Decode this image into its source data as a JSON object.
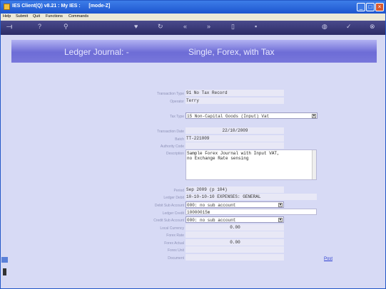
{
  "window": {
    "title": "IES Client(Q) v8.21 : My IES :      [mode-Z]"
  },
  "menu": [
    "Help",
    "Submit",
    "Quit",
    "Functions",
    "Commands"
  ],
  "header": {
    "left": "Ledger Journal: -",
    "right": "Single, Forex, with Tax"
  },
  "form": {
    "transaction_type": {
      "label": "Transaction Type",
      "value": "91 No Tax Record"
    },
    "operator": {
      "label": "Operator",
      "value": "Terry"
    },
    "tax_type": {
      "label": "Tax Type",
      "value": "15 Non-Capital Goods (Input) Vat"
    },
    "transaction_date": {
      "label": "Transaction Date",
      "value": "22/10/2009"
    },
    "batch": {
      "label": "Batch",
      "value": "TT-221009"
    },
    "authority_code": {
      "label": "Authority Code",
      "value": ""
    },
    "description": {
      "label": "Description",
      "line1": "Sample Forex Journal with Input VAT,",
      "line2": "no Exchange Rate sensing"
    },
    "period": {
      "label": "Period",
      "value": "Sep 2009 (p 104)"
    },
    "ledger_debit": {
      "label": "Ledger Debit",
      "value": "10-10-10-10 EXPENSES: GENERAL"
    },
    "debit_sub_account": {
      "label": "Debit Sub Account",
      "value": "000: no sub account"
    },
    "ledger_credit": {
      "label": "Ledger Credit",
      "value": "10000015m"
    },
    "credit_sub_account": {
      "label": "Credit Sub Account",
      "value": "000: no sub account"
    },
    "local_currency": {
      "label": "Local Currency",
      "value": "0.00"
    },
    "forex_rate": {
      "label": "Forex Rate",
      "value": ""
    },
    "forex_actual": {
      "label": "Forex Actual",
      "value": "0.00"
    },
    "forex_unit": {
      "label": "Forex Unit",
      "value": ""
    },
    "document": {
      "label": "Document",
      "value": ""
    }
  },
  "actions": {
    "post": "Post"
  }
}
